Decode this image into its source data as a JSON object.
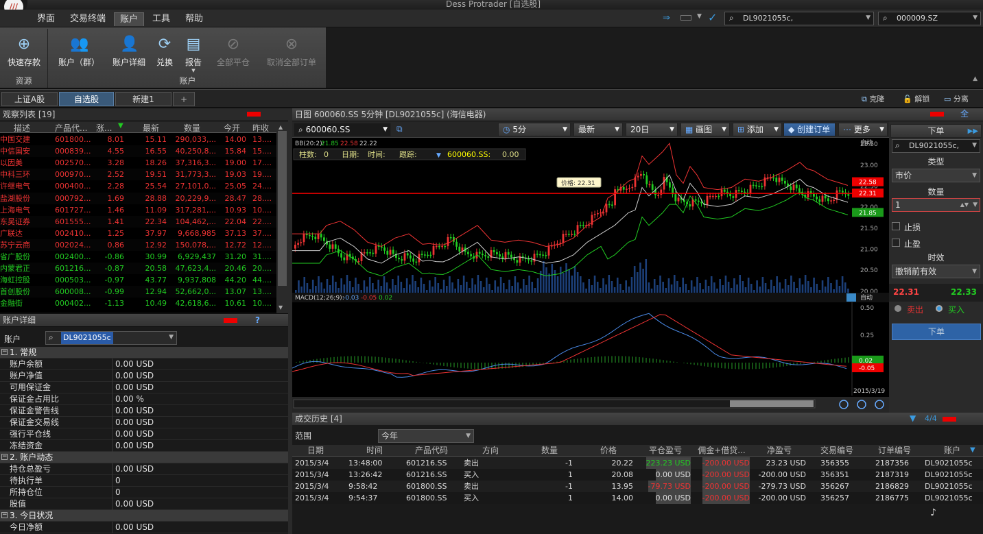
{
  "window": {
    "title": "Dess Protrader",
    "subtitle": "[自选股]"
  },
  "menu": [
    "界面",
    "交易终端",
    "账户",
    "工具",
    "帮助"
  ],
  "top_right": {
    "account": "DL9021055c,",
    "symbol": "000009.SZ"
  },
  "ribbon": {
    "fund_btn": "快速存款",
    "fund_group": "资源",
    "buttons": [
      "账户（群）",
      "账户详细",
      "兑换",
      "报告",
      "全部平仓",
      "取消全部订单"
    ],
    "group": "账户"
  },
  "workspace_tabs": [
    "上证A股",
    "自选股",
    "新建1",
    "+"
  ],
  "workspace_tools": [
    "克隆",
    "解锁",
    "分离"
  ],
  "watchlist": {
    "title": "观察列表",
    "count": "[19]",
    "headers": [
      "描述",
      "产品代...",
      "涨...",
      "最新",
      "数量",
      "今开",
      "昨收"
    ],
    "rows": [
      {
        "name": "中国交建",
        "code": "601800...",
        "chg": "8.01",
        "last": "15.11",
        "vol": "290,033,...",
        "open": "14.00",
        "prev": "13...."
      },
      {
        "name": "中信国安",
        "code": "000839...",
        "chg": "4.55",
        "last": "16.55",
        "vol": "40,250,8...",
        "open": "15.84",
        "prev": "15...."
      },
      {
        "name": "以因美",
        "code": "002570...",
        "chg": "3.28",
        "last": "18.26",
        "vol": "37,316,3...",
        "open": "19.00",
        "prev": "17...."
      },
      {
        "name": "中科三环",
        "code": "000970...",
        "chg": "2.52",
        "last": "19.51",
        "vol": "31,773,3...",
        "open": "19.03",
        "prev": "19...."
      },
      {
        "name": "许继电气",
        "code": "000400...",
        "chg": "2.28",
        "last": "25.54",
        "vol": "27,101,0...",
        "open": "25.05",
        "prev": "24...."
      },
      {
        "name": "盐湖股份",
        "code": "000792...",
        "chg": "1.69",
        "last": "28.88",
        "vol": "20,229,9...",
        "open": "28.47",
        "prev": "28...."
      },
      {
        "name": "上海电气",
        "code": "601727...",
        "chg": "1.46",
        "last": "11.09",
        "vol": "317,281,...",
        "open": "10.93",
        "prev": "10...."
      },
      {
        "name": "东吴证券",
        "code": "601555...",
        "chg": "1.41",
        "last": "22.34",
        "vol": "104,462,...",
        "open": "22.04",
        "prev": "22...."
      },
      {
        "name": "广联达",
        "code": "002410...",
        "chg": "1.25",
        "last": "37.97",
        "vol": "9,668,985",
        "open": "37.13",
        "prev": "37...."
      },
      {
        "name": "苏宁云商",
        "code": "002024...",
        "chg": "0.86",
        "last": "12.92",
        "vol": "150,078,...",
        "open": "12.72",
        "prev": "12...."
      },
      {
        "name": "省广股份",
        "code": "002400...",
        "chg": "-0.86",
        "last": "30.99",
        "vol": "6,929,437",
        "open": "31.20",
        "prev": "31...."
      },
      {
        "name": "内蒙君正",
        "code": "601216...",
        "chg": "-0.87",
        "last": "20.58",
        "vol": "47,623,4...",
        "open": "20.46",
        "prev": "20...."
      },
      {
        "name": "海虹控股",
        "code": "000503...",
        "chg": "-0.97",
        "last": "43.77",
        "vol": "9,937,808",
        "open": "44.20",
        "prev": "44...."
      },
      {
        "name": "首创股份",
        "code": "600008...",
        "chg": "-0.99",
        "last": "12.94",
        "vol": "52,662,0...",
        "open": "13.07",
        "prev": "13...."
      },
      {
        "name": "金融街",
        "code": "000402...",
        "chg": "-1.13",
        "last": "10.49",
        "vol": "42,618,6...",
        "open": "10.61",
        "prev": "10...."
      }
    ]
  },
  "account_detail": {
    "title": "账户详细",
    "label": "账户",
    "account": "DL9021055c",
    "sections": [
      {
        "name": "1. 常规",
        "rows": [
          [
            "账户余额",
            "0.00 USD"
          ],
          [
            "账户净值",
            "0.00 USD"
          ],
          [
            "可用保证金",
            "0.00 USD"
          ],
          [
            "保证金占用比",
            "0.00 %"
          ],
          [
            "保证金警告线",
            "0.00 USD"
          ],
          [
            "保证金交易线",
            "0.00 USD"
          ],
          [
            "强行平仓线",
            "0.00 USD"
          ],
          [
            "冻结资金",
            "0.00 USD"
          ]
        ]
      },
      {
        "name": "2. 账户动态",
        "rows": [
          [
            "持仓总盈亏",
            "0.00 USD"
          ],
          [
            "待执行单",
            "0"
          ],
          [
            "所持仓位",
            "0"
          ],
          [
            "股值",
            "0.00 USD"
          ]
        ]
      },
      {
        "name": "3. 今日状况",
        "rows": [
          [
            "今日净额",
            "0.00 USD"
          ]
        ]
      }
    ]
  },
  "chart": {
    "title": "日图 600060.SS 5分钟 [DL9021055c] (海信电器)",
    "symbol": "600060.SS",
    "interval": "5分",
    "mode": "最新",
    "range": "20日",
    "draw": "画图",
    "add": "添加",
    "create_order": "创建订单",
    "more": "更多",
    "bb_label": "BB(20:2):",
    "bb_vals": [
      "21.85",
      "22.58",
      "22.22"
    ],
    "info": {
      "bars": "柱数:",
      "bars_v": "0",
      "date": "日期:",
      "time": "时间:",
      "track": "跟踪:",
      "sym": "600060.SS:",
      "val": "0.00"
    },
    "price_tag": "价格: 22.31",
    "price_axis": [
      "23.50",
      "23.00",
      "22.50",
      "22.00",
      "21.50",
      "21.00",
      "20.50",
      "20.00"
    ],
    "price_badges": [
      "22.58",
      "22.31",
      "21.85"
    ],
    "auto": "自动",
    "macd_label": "MACD(12;26;9):",
    "macd_vals": [
      "-0.03",
      "-0.05",
      "0.02"
    ],
    "macd_axis": [
      "0.50",
      "0.25"
    ],
    "macd_badges": [
      "0.02",
      "-0.05"
    ],
    "date_label": "2015/3/19"
  },
  "order": {
    "title": "下单",
    "account": "DL9021055c,",
    "type_label": "类型",
    "type": "市价",
    "qty_label": "数量",
    "qty": "1",
    "stop_loss": "止损",
    "take_profit": "止盈",
    "tif_label": "时效",
    "tif": "撤销前有效",
    "bid": "22.31",
    "ask": "22.33",
    "sell": "卖出",
    "buy": "买入",
    "submit": "下单"
  },
  "trades": {
    "title": "成交历史",
    "count": "[4]",
    "filter_count": "4/4",
    "range_label": "范围",
    "range": "今年",
    "headers": [
      "日期",
      "时间",
      "产品代码",
      "方向",
      "数量",
      "价格",
      "平仓盈亏",
      "佣金+借贷...",
      "净盈亏",
      "交易编号",
      "订单编号",
      "账户"
    ],
    "rows": [
      [
        "2015/3/4",
        "13:48:00",
        "601216.SS",
        "卖出",
        "-1",
        "20.22",
        "223.23 USD",
        "-200.00 USD",
        "23.23 USD",
        "356355",
        "2187356",
        "DL9021055c"
      ],
      [
        "2015/3/4",
        "13:26:42",
        "601216.SS",
        "买入",
        "1",
        "20.08",
        "0.00 USD",
        "-200.00 USD",
        "-200.00 USD",
        "356351",
        "2187319",
        "DL9021055c"
      ],
      [
        "2015/3/4",
        "9:58:42",
        "601800.SS",
        "卖出",
        "-1",
        "13.95",
        "-79.73 USD",
        "-200.00 USD",
        "-279.73 USD",
        "356267",
        "2186829",
        "DL9021055c"
      ],
      [
        "2015/3/4",
        "9:54:37",
        "601800.SS",
        "买入",
        "1",
        "14.00",
        "0.00 USD",
        "-200.00 USD",
        "-200.00 USD",
        "356257",
        "2186775",
        "DL9021055c"
      ]
    ]
  }
}
